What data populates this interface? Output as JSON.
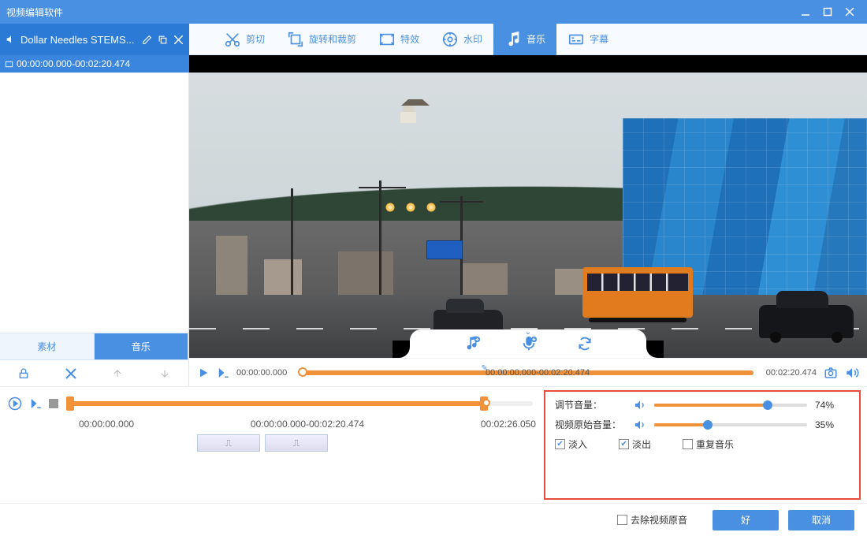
{
  "app": {
    "title": "视频编辑软件"
  },
  "file": {
    "name": "Dollar Needles STEMS...",
    "time_range": "00:00:00.000-00:02:20.474"
  },
  "toolbar": {
    "cut": "剪切",
    "rotate_crop": "旋转和裁剪",
    "effects": "特效",
    "watermark": "水印",
    "music": "音乐",
    "subtitle": "字幕",
    "active": "music"
  },
  "side_tabs": {
    "material": "素材",
    "music": "音乐",
    "active": "music"
  },
  "playbar": {
    "start": "00:00:00.000",
    "range": "00:00:00.000-00:02:20.474",
    "end": "00:02:20.474"
  },
  "timeline": {
    "start": "00:00:00.000",
    "range": "00:00:00.000-00:02:20.474",
    "end": "00:02:26.050"
  },
  "audio_panel": {
    "adjust_volume_label": "调节音量：",
    "adjust_volume_value": "74%",
    "adjust_volume_pct": 74,
    "original_volume_label": "视频原始音量：",
    "original_volume_value": "35%",
    "original_volume_pct": 35,
    "fade_in": "淡入",
    "fade_out": "淡出",
    "repeat_music": "重复音乐",
    "fade_in_checked": true,
    "fade_out_checked": true,
    "repeat_checked": false
  },
  "footer": {
    "remove_original_audio": "去除视频原音",
    "remove_checked": false,
    "ok": "好",
    "cancel": "取消"
  }
}
